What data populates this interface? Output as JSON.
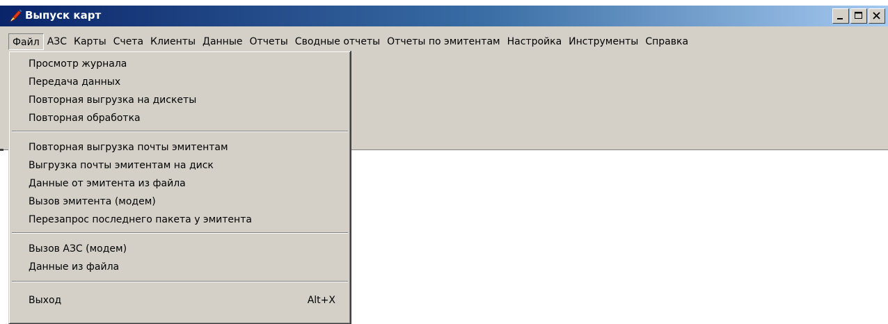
{
  "window": {
    "title": "Выпуск карт",
    "icon": "pen-flame-icon",
    "accent_colors": {
      "title_start": "#0a246a",
      "title_end": "#a6caf0",
      "face": "#d4d0c8"
    }
  },
  "menubar": {
    "items": [
      {
        "label": "Файл",
        "open": true
      },
      {
        "label": "АЗС"
      },
      {
        "label": "Карты"
      },
      {
        "label": "Счета"
      },
      {
        "label": "Клиенты"
      },
      {
        "label": "Данные"
      },
      {
        "label": "Отчеты"
      },
      {
        "label": "Сводные отчеты"
      },
      {
        "label": "Отчеты по эмитентам"
      },
      {
        "label": "Настройка"
      },
      {
        "label": "Инструменты"
      },
      {
        "label": "Справка"
      }
    ]
  },
  "file_menu": {
    "items": [
      {
        "label": "Просмотр журнала"
      },
      {
        "label": "Передача данных"
      },
      {
        "label": "Повторная выгрузка на дискеты"
      },
      {
        "label": "Повторная обработка"
      },
      {
        "label": "Повторная выгрузка почты эмитентам"
      },
      {
        "label": "Выгрузка почты эмитентам на диск"
      },
      {
        "label": "Данные от эмитента из файла"
      },
      {
        "label": "Вызов эмитента (модем)"
      },
      {
        "label": "Перезапрос последнего пакета у эмитента"
      },
      {
        "label": "Вызов АЗС (модем)"
      },
      {
        "label": "Данные из файла"
      },
      {
        "label": "Выход",
        "shortcut": "Alt+X"
      }
    ]
  }
}
